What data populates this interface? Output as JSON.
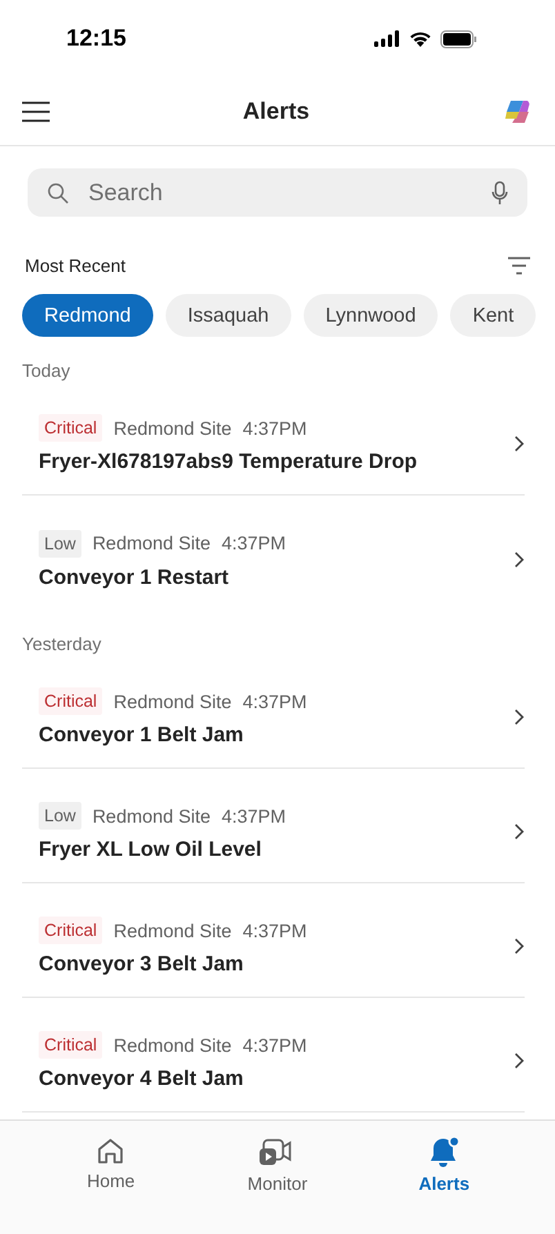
{
  "status_bar": {
    "time": "12:15"
  },
  "header": {
    "title": "Alerts"
  },
  "search": {
    "placeholder": "Search"
  },
  "sort": {
    "label": "Most Recent"
  },
  "chips": [
    {
      "label": "Redmond",
      "selected": true
    },
    {
      "label": "Issaquah",
      "selected": false
    },
    {
      "label": "Lynnwood",
      "selected": false
    },
    {
      "label": "Kent",
      "selected": false
    }
  ],
  "sections": [
    {
      "heading": "Today",
      "alerts": [
        {
          "severity": "Critical",
          "kind": "critical",
          "site": "Redmond Site",
          "time": "4:37PM",
          "title": "Fryer-Xl678197abs9 Temperature Drop"
        },
        {
          "severity": "Low",
          "kind": "low",
          "site": "Redmond Site",
          "time": "4:37PM",
          "title": "Conveyor 1 Restart"
        }
      ]
    },
    {
      "heading": "Yesterday",
      "alerts": [
        {
          "severity": "Critical",
          "kind": "critical",
          "site": "Redmond Site",
          "time": "4:37PM",
          "title": "Conveyor 1 Belt Jam"
        },
        {
          "severity": "Low",
          "kind": "low",
          "site": "Redmond Site",
          "time": "4:37PM",
          "title": "Fryer XL Low Oil Level"
        },
        {
          "severity": "Critical",
          "kind": "critical",
          "site": "Redmond Site",
          "time": "4:37PM",
          "title": "Conveyor 3 Belt Jam"
        },
        {
          "severity": "Critical",
          "kind": "critical",
          "site": "Redmond Site",
          "time": "4:37PM",
          "title": "Conveyor 4 Belt Jam"
        }
      ]
    }
  ],
  "nav": [
    {
      "label": "Home",
      "kind": "home",
      "selected": false
    },
    {
      "label": "Monitor",
      "kind": "monitor",
      "selected": false
    },
    {
      "label": "Alerts",
      "kind": "alerts",
      "selected": true
    }
  ]
}
